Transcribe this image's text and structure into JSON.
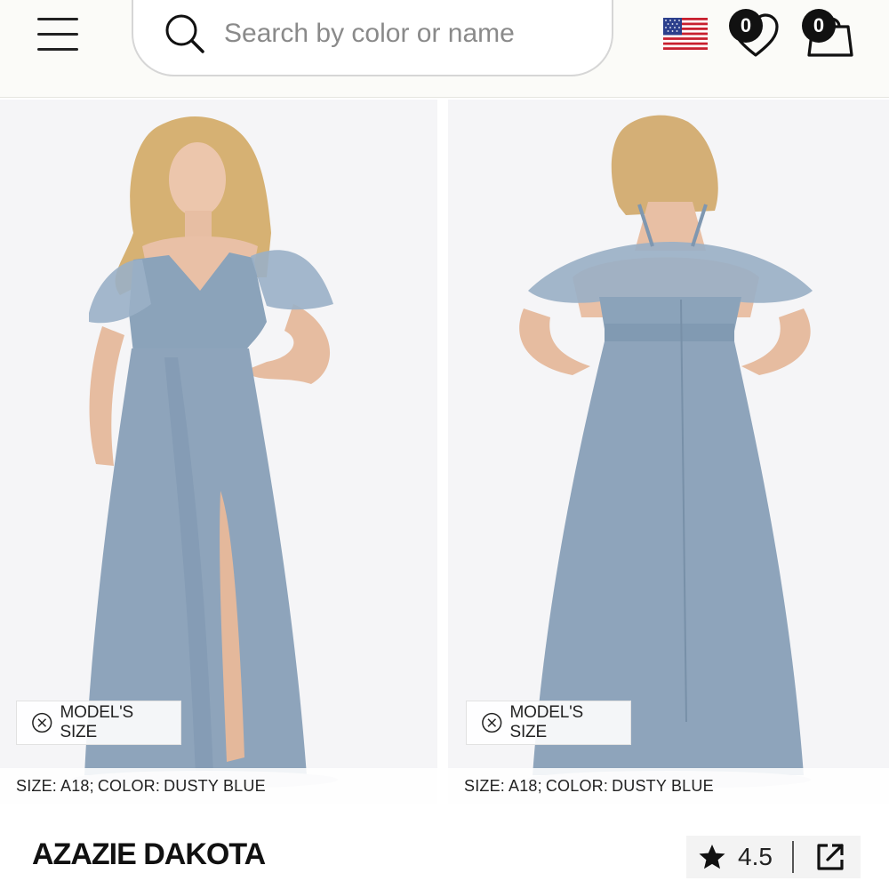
{
  "header": {
    "search": {
      "placeholder": "Search by color or name"
    },
    "wishlist_count": "0",
    "cart_count": "0",
    "region_flag": "us-flag-icon"
  },
  "gallery": {
    "images": [
      {
        "view": "front",
        "chip_label": "MODEL'S SIZE",
        "size_label": "SIZE:",
        "size_value": "A18;",
        "color_label": "COLOR:",
        "color_value": "DUSTY BLUE"
      },
      {
        "view": "back",
        "chip_label": "MODEL'S SIZE",
        "size_label": "SIZE:",
        "size_value": "A18;",
        "color_label": "COLOR:",
        "color_value": "DUSTY BLUE"
      }
    ]
  },
  "product": {
    "name": "AZAZIE DAKOTA",
    "rating": "4.5"
  },
  "colors": {
    "dress": "#8ea4bb",
    "dress_shadow": "#7891aa",
    "skin": "#e9c0a6",
    "hair": "#d9b57a",
    "accent": "#111111"
  }
}
